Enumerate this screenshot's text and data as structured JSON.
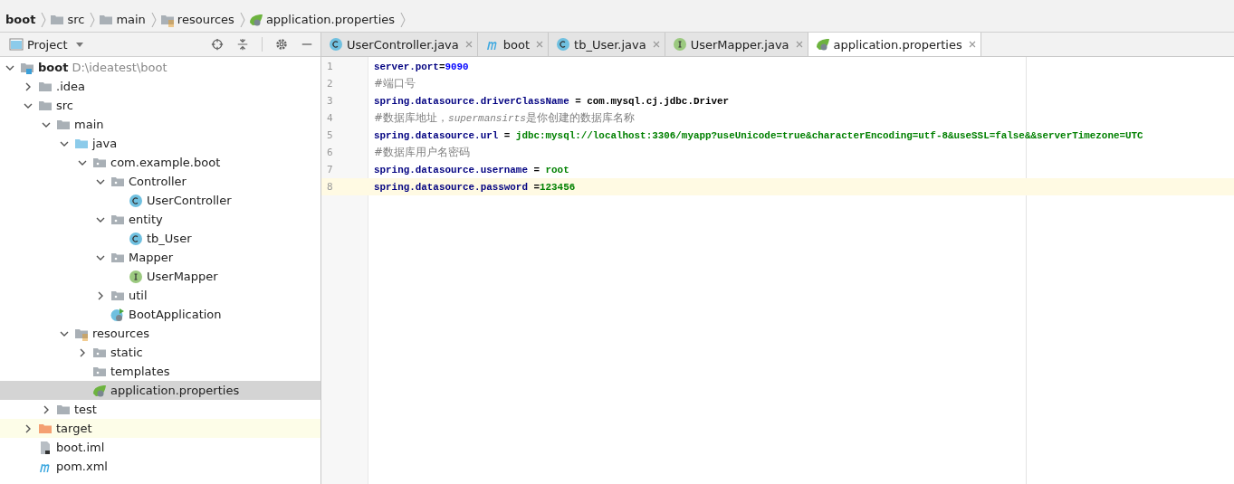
{
  "breadcrumb": [
    {
      "label": "boot",
      "kind": "module"
    },
    {
      "label": "src",
      "kind": "folder"
    },
    {
      "label": "main",
      "kind": "folder"
    },
    {
      "label": "resources",
      "kind": "resources"
    },
    {
      "label": "application.properties",
      "kind": "spring"
    }
  ],
  "project_panel": {
    "title": "Project"
  },
  "tree": [
    {
      "label": "boot",
      "path": "D:\\ideatest\\boot",
      "kind": "module",
      "expanded": true,
      "selected": false,
      "children": [
        {
          "label": ".idea",
          "kind": "folder",
          "expanded": false,
          "selected": false
        },
        {
          "label": "src",
          "kind": "folder",
          "expanded": true,
          "selected": false,
          "children": [
            {
              "label": "main",
              "kind": "folder",
              "expanded": true,
              "selected": false,
              "children": [
                {
                  "label": "java",
                  "kind": "source",
                  "expanded": true,
                  "selected": false,
                  "children": [
                    {
                      "label": "com.example.boot",
                      "kind": "package",
                      "expanded": true,
                      "selected": false,
                      "children": [
                        {
                          "label": "Controller",
                          "kind": "package",
                          "expanded": true,
                          "selected": false,
                          "children": [
                            {
                              "label": "UserController",
                              "kind": "class",
                              "selected": false
                            }
                          ]
                        },
                        {
                          "label": "entity",
                          "kind": "package",
                          "expanded": true,
                          "selected": false,
                          "children": [
                            {
                              "label": "tb_User",
                              "kind": "class",
                              "selected": false
                            }
                          ]
                        },
                        {
                          "label": "Mapper",
                          "kind": "package",
                          "expanded": true,
                          "selected": false,
                          "children": [
                            {
                              "label": "UserMapper",
                              "kind": "interface",
                              "selected": false
                            }
                          ]
                        },
                        {
                          "label": "util",
                          "kind": "package",
                          "expanded": false,
                          "selected": false
                        },
                        {
                          "label": "BootApplication",
                          "kind": "app",
                          "selected": false
                        }
                      ]
                    }
                  ]
                },
                {
                  "label": "resources",
                  "kind": "resources",
                  "expanded": true,
                  "selected": false,
                  "children": [
                    {
                      "label": "static",
                      "kind": "package",
                      "expanded": false,
                      "selected": false
                    },
                    {
                      "label": "templates",
                      "kind": "package",
                      "selected": false
                    },
                    {
                      "label": "application.properties",
                      "kind": "spring",
                      "selected": true
                    }
                  ]
                }
              ]
            },
            {
              "label": "test",
              "kind": "folder",
              "expanded": false,
              "selected": false
            }
          ]
        },
        {
          "label": "target",
          "kind": "excluded",
          "expanded": false,
          "selected": false
        },
        {
          "label": "boot.iml",
          "kind": "iml",
          "selected": false
        },
        {
          "label": "pom.xml",
          "kind": "maven",
          "selected": false
        }
      ]
    }
  ],
  "tabs": [
    {
      "label": "UserController.java",
      "kind": "class",
      "selected": false
    },
    {
      "label": "boot",
      "kind": "maven",
      "selected": false
    },
    {
      "label": "tb_User.java",
      "kind": "class",
      "selected": false
    },
    {
      "label": "UserMapper.java",
      "kind": "interface",
      "selected": false
    },
    {
      "label": "application.properties",
      "kind": "spring",
      "selected": true
    }
  ],
  "editor": {
    "lines": [
      {
        "number": "1",
        "current": false,
        "segments": [
          {
            "kind": "key",
            "text": "server.port"
          },
          {
            "kind": "plain",
            "text": "="
          },
          {
            "kind": "number",
            "text": "9090"
          }
        ]
      },
      {
        "number": "2",
        "current": false,
        "segments": [
          {
            "kind": "comment",
            "text": "#端口号"
          }
        ]
      },
      {
        "number": "3",
        "current": false,
        "segments": [
          {
            "kind": "key",
            "text": "spring.datasource.driverClassName"
          },
          {
            "kind": "plain",
            "text": " = com.mysql.cj.jdbc.Driver"
          }
        ]
      },
      {
        "number": "4",
        "current": false,
        "segments": [
          {
            "kind": "comment",
            "text": "#数据库地址，"
          },
          {
            "kind": "comment-italic",
            "text": "supermansirts"
          },
          {
            "kind": "comment",
            "text": "是你创建的数据库名称"
          }
        ]
      },
      {
        "number": "5",
        "current": false,
        "segments": [
          {
            "kind": "key",
            "text": "spring.datasource.url"
          },
          {
            "kind": "plain",
            "text": " = "
          },
          {
            "kind": "string",
            "text": "jdbc:mysql://localhost:3306/myapp?useUnicode=true&characterEncoding=utf-8&useSSL=false&&serverTimezone=UTC"
          }
        ]
      },
      {
        "number": "6",
        "current": false,
        "segments": [
          {
            "kind": "comment",
            "text": "#数据库用户名密码"
          }
        ]
      },
      {
        "number": "7",
        "current": false,
        "segments": [
          {
            "kind": "key",
            "text": "spring.datasource.username"
          },
          {
            "kind": "plain",
            "text": " = "
          },
          {
            "kind": "string",
            "text": "root"
          }
        ]
      },
      {
        "number": "8",
        "current": true,
        "segments": [
          {
            "kind": "key",
            "text": "spring.datasource.password"
          },
          {
            "kind": "plain",
            "text": " ="
          },
          {
            "kind": "string",
            "text": "123456"
          }
        ]
      }
    ]
  }
}
